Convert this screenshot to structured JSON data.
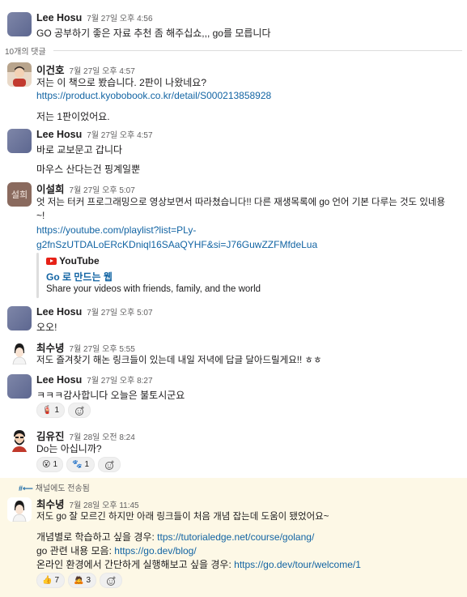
{
  "parent": {
    "author": "Lee Hosu",
    "time": "7월 27일 오후 4:56",
    "text": "GO 공부하기 좋은 자료 추천 좀 해주십쇼,,, go를 모릅니다"
  },
  "replies_label": "10개의 댓글",
  "messages": [
    {
      "author": "이건호",
      "time": "7월 27일 오후 4:57",
      "text": "저는 이 책으로 봤습니다. 2판이 나왔네요?",
      "link": "https://product.kyobobook.co.kr/detail/S000213858928",
      "text2": "저는 1판이었어요."
    },
    {
      "author": "Lee Hosu",
      "time": "7월 27일 오후 4:57",
      "text": "바로 교보문고 갑니다",
      "text2": "마우스 산다는건 핑계일뿐"
    },
    {
      "author": "이설희",
      "avatar_text": "설희",
      "time": "7월 27일 오후 5:07",
      "text": "엇 저는 터커 프로그래밍으로 영상보면서 따라쳤습니다!! 다른 재생목록에 go 언어 기본 다루는 것도 있네용",
      "text_cont": "~!",
      "link1": "https://youtube.com/playlist?list=PLy-",
      "link2": "g2fnSzUTDALoERcKDniql16SAaQYHF&si=J76GuwZZFMfdeLua",
      "unfurl": {
        "source": "YouTube",
        "title": "Go 로 만드는 웹",
        "desc": "Share your videos with friends, family, and the world"
      }
    },
    {
      "author": "Lee Hosu",
      "time": "7월 27일 오후 5:07",
      "text": "오오!"
    },
    {
      "author": "최수녕",
      "time": "7월 27일 오후 5:55",
      "text": "저도 즐겨찾기 해논 링크들이 있는데 내일 저녁에 답글 달아드릴게요!! ㅎㅎ"
    },
    {
      "author": "Lee Hosu",
      "time": "7월 27일 오후 8:27",
      "text": "ㅋㅋㅋ감사합니다 오늘은 불토시군요",
      "reactions": [
        {
          "emoji": "🧯",
          "count": "1"
        }
      ]
    },
    {
      "author": "김유진",
      "time": "7월 28일 오전 8:24",
      "text": "Do는 아십니까?",
      "reactions": [
        {
          "emoji": "😮",
          "count": "1"
        },
        {
          "emoji": "🐾",
          "count": "1"
        }
      ]
    },
    {
      "also_sent": "채널에도 전송됨",
      "author": "최수녕",
      "time": "7월 28일 오후 11:45",
      "text": "저도 go 잘 모르긴 하지만 아래 링크들이 처음 개념 잡는데 도움이 됐었어요~",
      "l1_label": "개념별로 학습하고 싶을 경우: ",
      "l1_link": "ttps://tutorialedge.net/course/golang/",
      "l2_label": "go 관련 내용 모음: ",
      "l2_link": "https://go.dev/blog/",
      "l3_label": "온라인 환경에서 간단하게 실행해보고 싶을 경우: ",
      "l3_link": "https://go.dev/tour/welcome/1",
      "reactions": [
        {
          "emoji": "👍",
          "count": "7"
        },
        {
          "emoji": "🙇",
          "count": "3"
        }
      ]
    }
  ],
  "colors": {
    "link": "#1264a3",
    "highlight": "#fdf8e6",
    "text": "#1d1c1d",
    "muted": "#616061"
  },
  "icons": {
    "add_reaction": "add-reaction-icon",
    "youtube": "youtube-icon",
    "also_sent": "thread-broadcast-icon"
  }
}
